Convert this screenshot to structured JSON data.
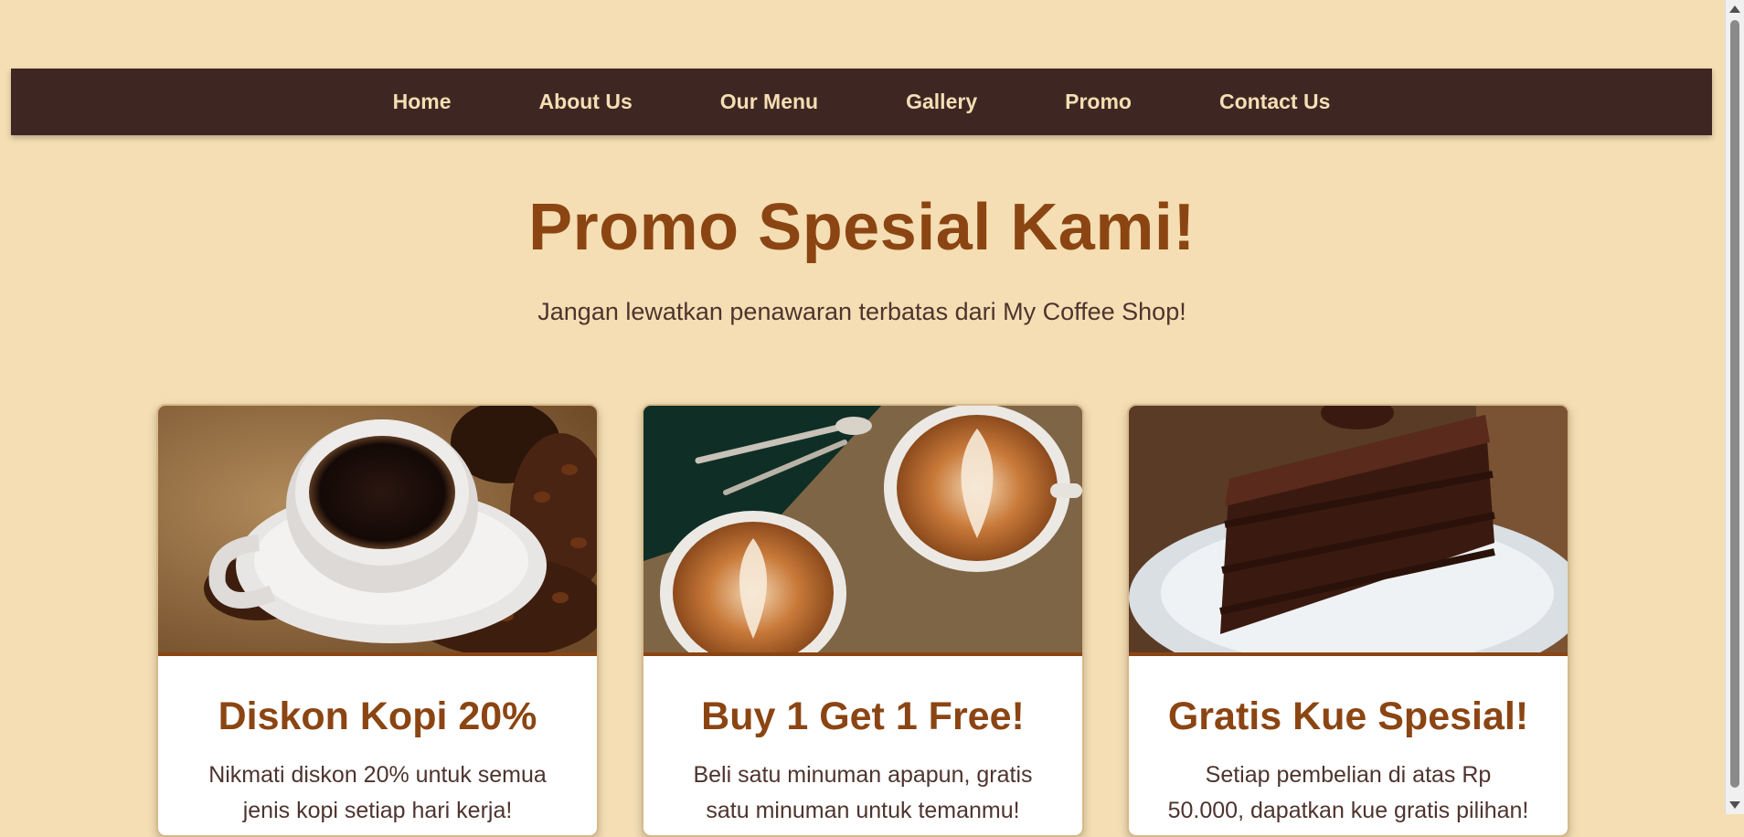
{
  "nav": {
    "items": [
      {
        "label": "Home"
      },
      {
        "label": "About Us"
      },
      {
        "label": "Our Menu"
      },
      {
        "label": "Gallery"
      },
      {
        "label": "Promo"
      },
      {
        "label": "Contact Us"
      }
    ]
  },
  "hero": {
    "title": "Promo Spesial Kami!",
    "subtitle": "Jangan lewatkan penawaran terbatas dari My Coffee Shop!"
  },
  "promos": [
    {
      "title": "Diskon Kopi 20%",
      "description": "Nikmati diskon 20% untuk semua jenis kopi setiap hari kerja!"
    },
    {
      "title": "Buy 1 Get 1 Free!",
      "description": "Beli satu minuman apapun, gratis satu minuman untuk temanmu!"
    },
    {
      "title": "Gratis Kue Spesial!",
      "description": "Setiap pembelian di atas Rp 50.000, dapatkan kue gratis pilihan!"
    }
  ],
  "colors": {
    "background": "#f5deb3",
    "nav_background": "#3e2723",
    "accent": "#8b4513",
    "text": "#4e342e"
  }
}
